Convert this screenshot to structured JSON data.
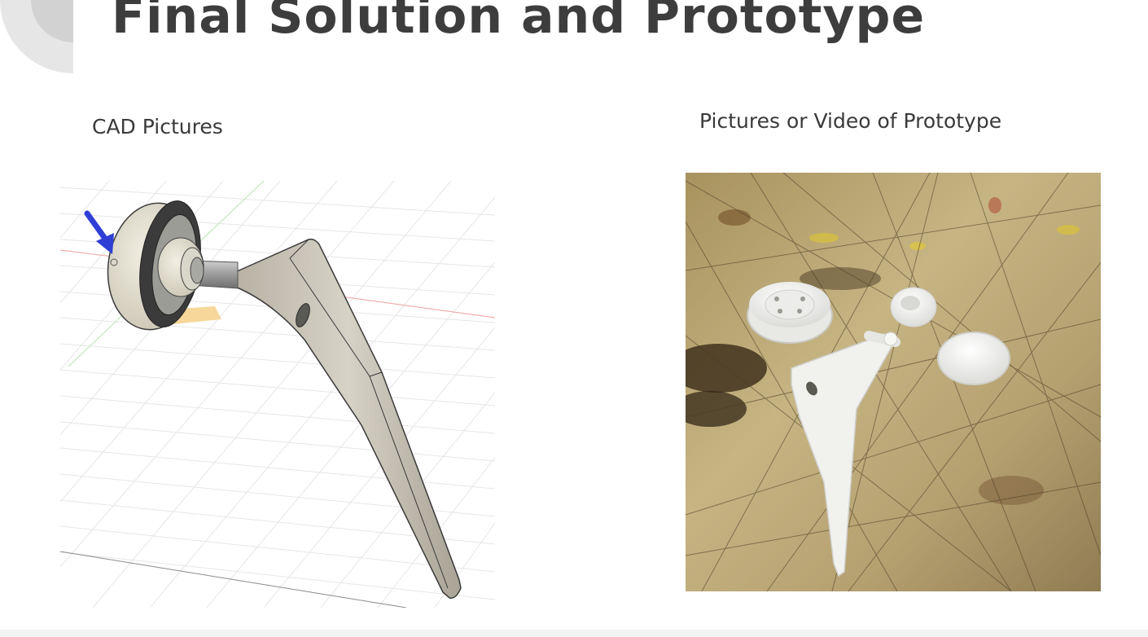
{
  "slide": {
    "title": "Final Solution and Prototype"
  },
  "left_panel": {
    "caption": "CAD Pictures",
    "image": "cad-render-hip-implant"
  },
  "right_panel": {
    "caption": "Pictures or Video of Prototype",
    "image": "photo-3d-printed-prototype"
  },
  "colors": {
    "title": "#3d3d3d",
    "caption": "#3a3a3a",
    "decoration": "#e4e4e4",
    "arrow": "#2f3fd6"
  }
}
